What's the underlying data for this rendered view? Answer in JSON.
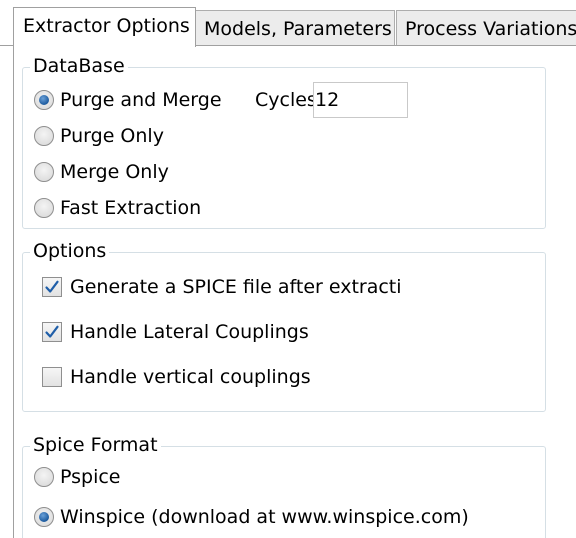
{
  "tabs": [
    {
      "label": "Extractor Options",
      "active": true
    },
    {
      "label": "Models, Parameters",
      "active": false
    },
    {
      "label": "Process Variations",
      "active": false
    }
  ],
  "database": {
    "legend": "DataBase",
    "options": [
      {
        "label": "Purge and Merge",
        "checked": true
      },
      {
        "label": "Purge Only",
        "checked": false
      },
      {
        "label": "Merge Only",
        "checked": false
      },
      {
        "label": "Fast Extraction",
        "checked": false
      }
    ],
    "cycles_label": "Cycles",
    "cycles_value": "12"
  },
  "options": {
    "legend": "Options",
    "items": [
      {
        "label": "Generate a SPICE file after extracti",
        "checked": true
      },
      {
        "label": "Handle Lateral Couplings",
        "checked": true
      },
      {
        "label": "Handle vertical couplings",
        "checked": false
      }
    ]
  },
  "spice_format": {
    "legend": "Spice Format",
    "options": [
      {
        "label": "Pspice",
        "checked": false
      },
      {
        "label": "Winspice (download at www.winspice.com)",
        "checked": true
      }
    ]
  },
  "colors": {
    "check_tick": "#1f5ea8",
    "radio_dot": "#1c5a9e",
    "group_border": "#d5dfe5"
  }
}
